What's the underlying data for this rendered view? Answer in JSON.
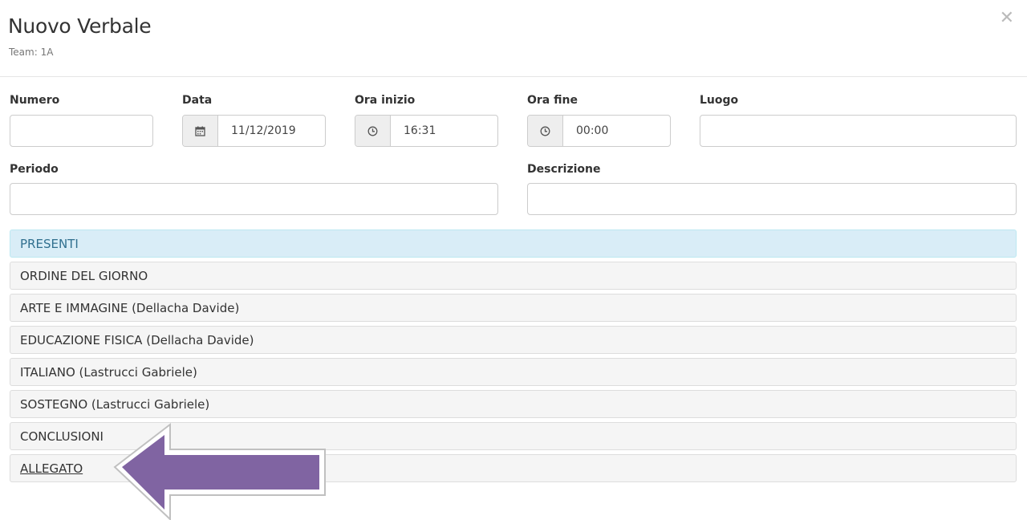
{
  "header": {
    "title": "Nuovo Verbale",
    "subtitle": "Team: 1A",
    "close_icon": "close-icon"
  },
  "form": {
    "numero": {
      "label": "Numero",
      "value": ""
    },
    "data": {
      "label": "Data",
      "value": "11/12/2019",
      "icon": "calendar-icon"
    },
    "ora_inizio": {
      "label": "Ora inizio",
      "value": "16:31",
      "icon": "clock-icon"
    },
    "ora_fine": {
      "label": "Ora fine",
      "value": "00:00",
      "icon": "clock-icon"
    },
    "luogo": {
      "label": "Luogo",
      "value": ""
    },
    "periodo": {
      "label": "Periodo",
      "value": ""
    },
    "descrizione": {
      "label": "Descrizione",
      "value": ""
    }
  },
  "sections": [
    {
      "label": "PRESENTI",
      "active": true
    },
    {
      "label": "ORDINE DEL GIORNO"
    },
    {
      "label": "ARTE E IMMAGINE (Dellacha Davide)"
    },
    {
      "label": "EDUCAZIONE FISICA (Dellacha Davide)"
    },
    {
      "label": "ITALIANO (Lastrucci Gabriele)"
    },
    {
      "label": "SOSTEGNO (Lastrucci Gabriele)"
    },
    {
      "label": "CONCLUSIONI"
    },
    {
      "label": "ALLEGATO",
      "link": true
    }
  ],
  "annotation": {
    "icon": "arrow-pointer-icon",
    "color": "#8064a2"
  }
}
